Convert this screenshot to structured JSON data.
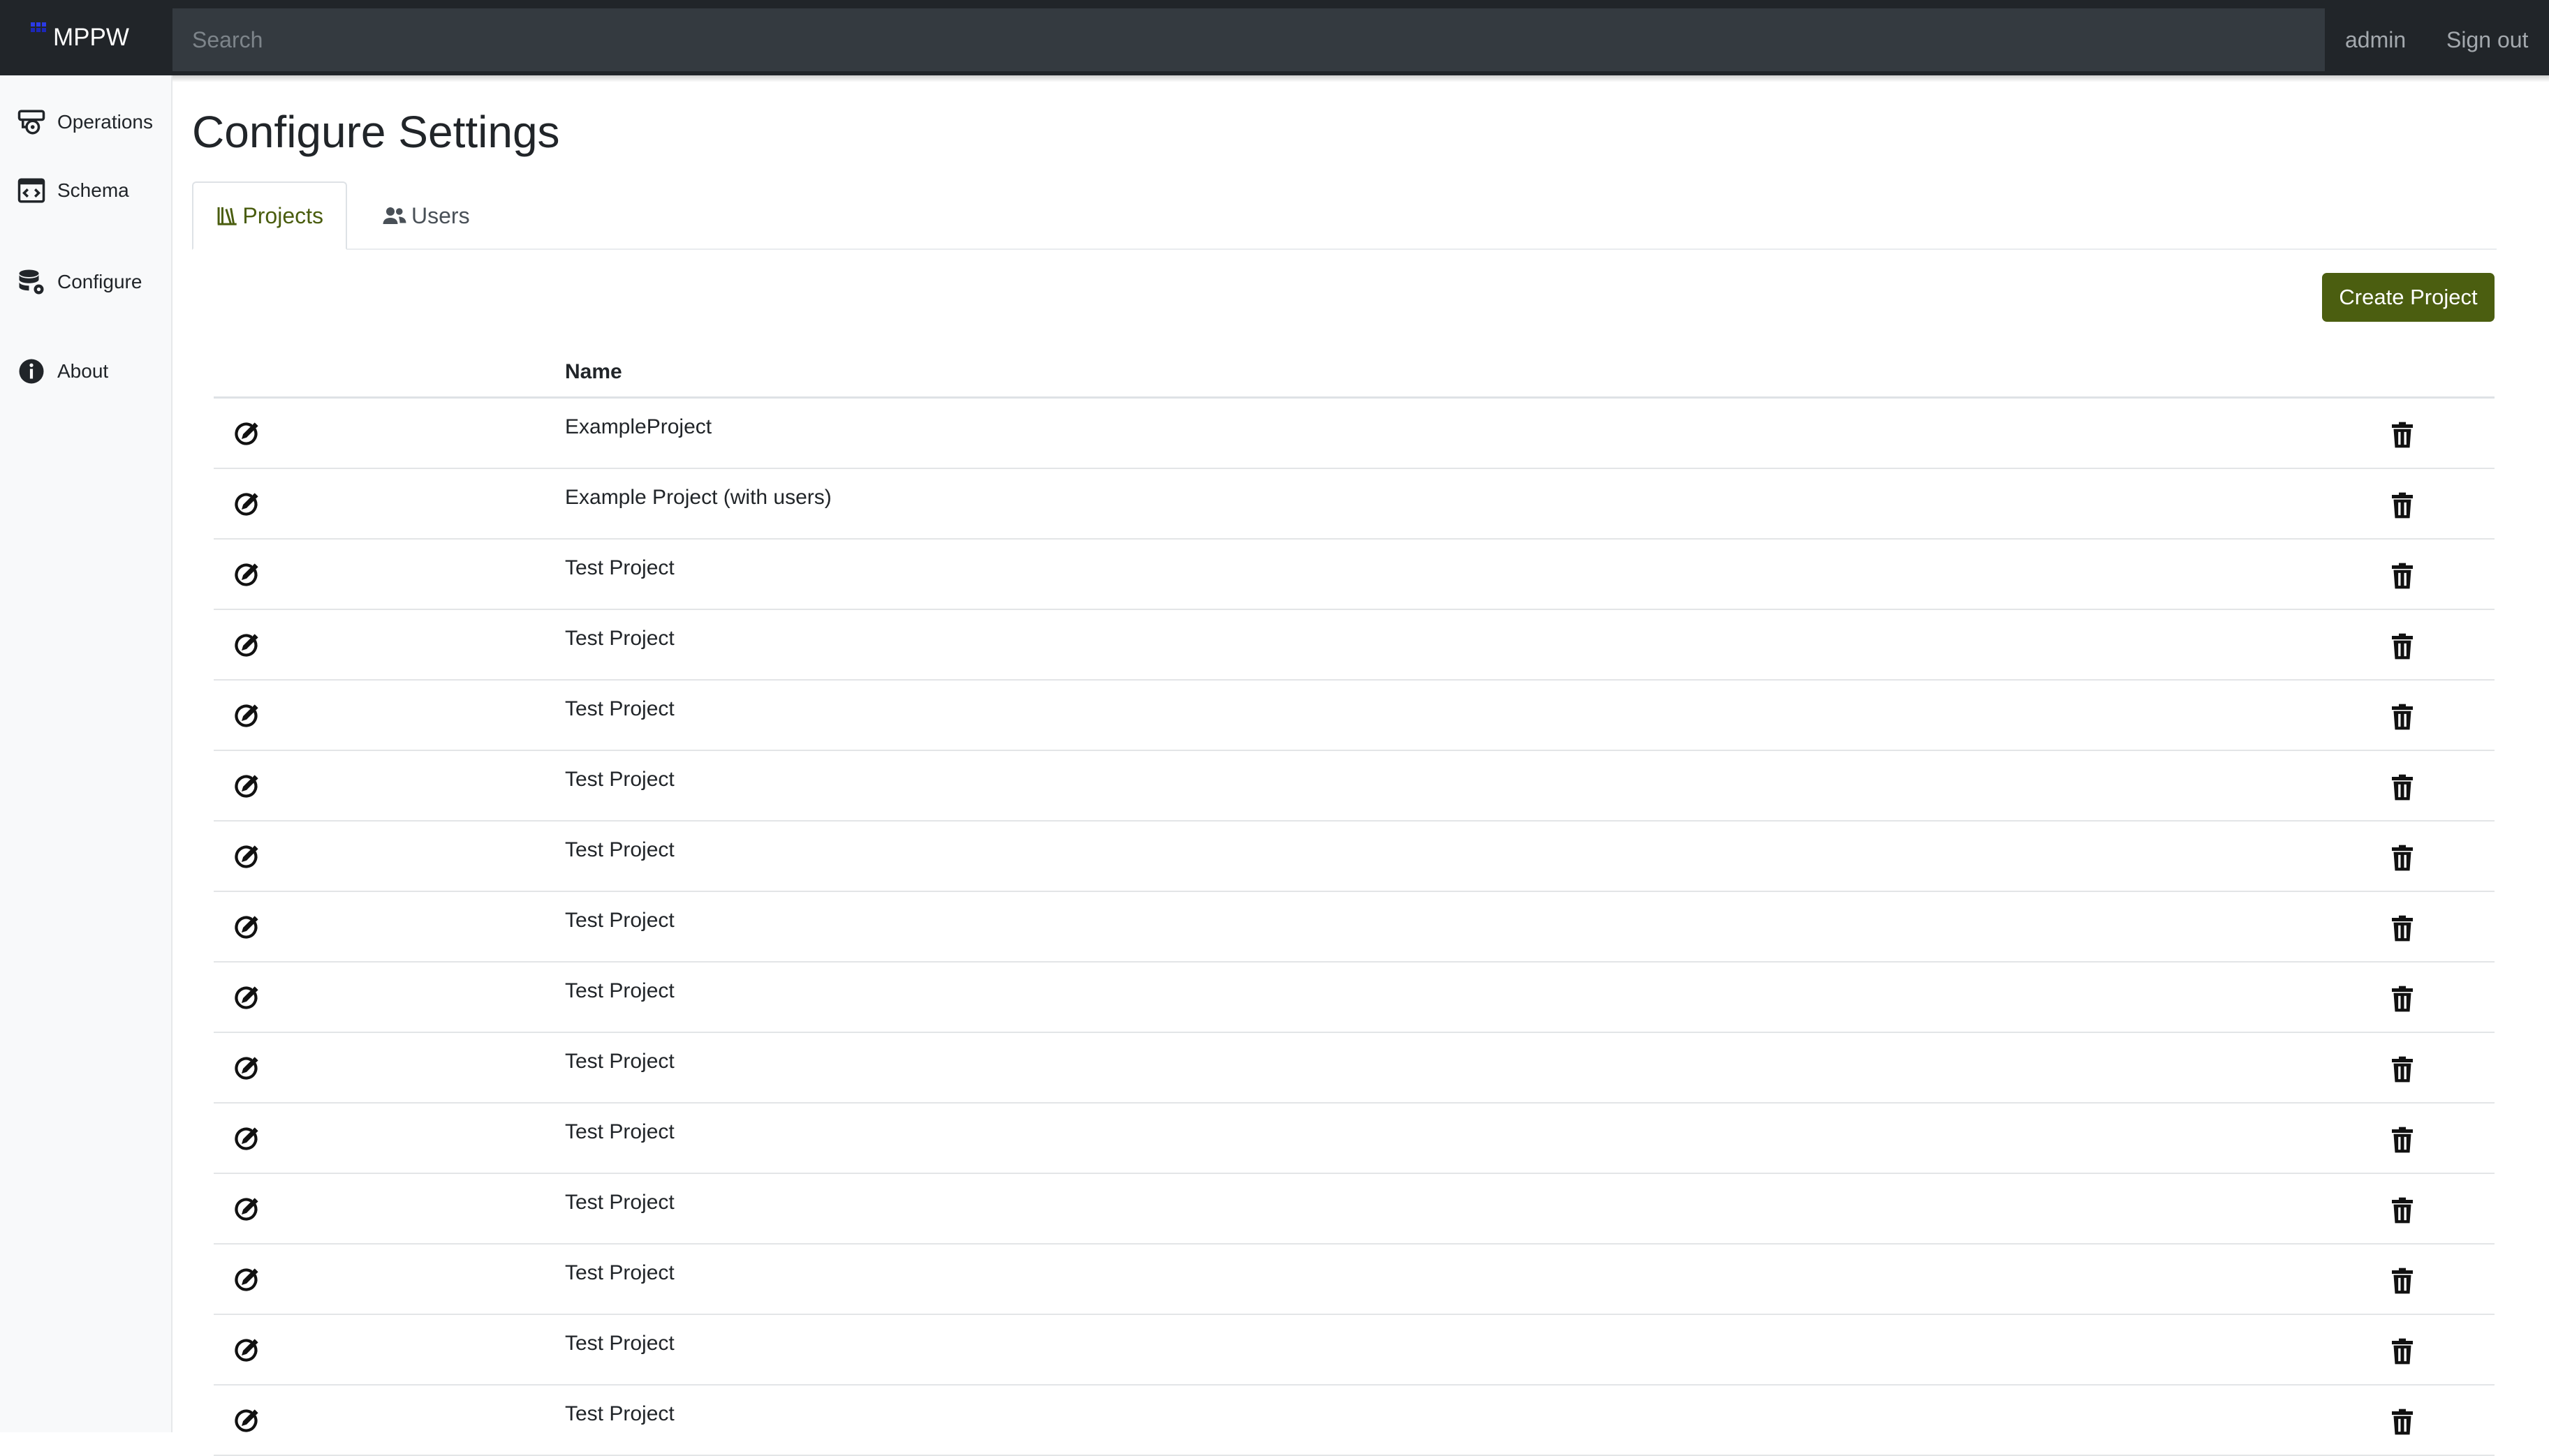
{
  "app": {
    "brand": "MPPW"
  },
  "header": {
    "search_placeholder": "Search",
    "user": "admin",
    "sign_out": "Sign out"
  },
  "sidebar": {
    "items": [
      {
        "label": "Operations",
        "icon": "operations-icon"
      },
      {
        "label": "Schema",
        "icon": "schema-icon"
      },
      {
        "label": "Configure",
        "icon": "configure-icon"
      },
      {
        "label": "About",
        "icon": "info-icon"
      }
    ]
  },
  "main": {
    "title": "Configure Settings",
    "tabs": [
      {
        "label": "Projects",
        "icon": "library-icon",
        "active": true
      },
      {
        "label": "Users",
        "icon": "users-icon",
        "active": false
      }
    ],
    "create_button": "Create Project",
    "table": {
      "columns": [
        "",
        "Name",
        ""
      ],
      "rows": [
        {
          "name": "ExampleProject"
        },
        {
          "name": "Example Project (with users)"
        },
        {
          "name": "Test Project"
        },
        {
          "name": "Test Project"
        },
        {
          "name": "Test Project"
        },
        {
          "name": "Test Project"
        },
        {
          "name": "Test Project"
        },
        {
          "name": "Test Project"
        },
        {
          "name": "Test Project"
        },
        {
          "name": "Test Project"
        },
        {
          "name": "Test Project"
        },
        {
          "name": "Test Project"
        },
        {
          "name": "Test Project"
        },
        {
          "name": "Test Project"
        },
        {
          "name": "Test Project"
        }
      ]
    }
  },
  "colors": {
    "navbar": "#212529",
    "accent": "#4b5e10",
    "sidebar": "#f8f9fa"
  }
}
